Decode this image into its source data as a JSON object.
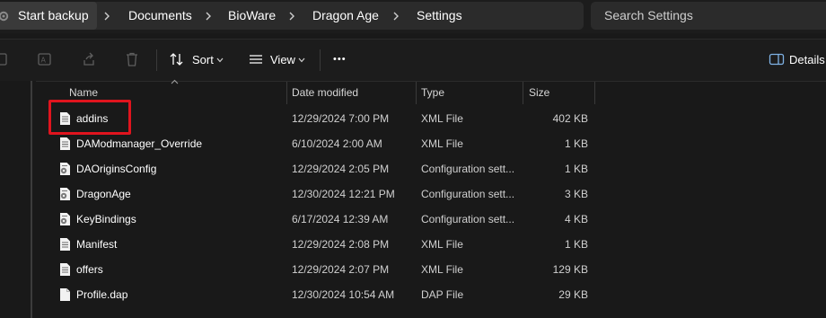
{
  "address_bar": {
    "first_crumb": "Start backup",
    "crumbs": [
      "Documents",
      "BioWare",
      "Dragon Age",
      "Settings"
    ],
    "search_placeholder": "Search Settings"
  },
  "toolbar": {
    "sort_label": "Sort",
    "view_label": "View",
    "more_label": "•••",
    "details_label": "Details"
  },
  "columns": {
    "name": "Name",
    "date": "Date modified",
    "type": "Type",
    "size": "Size"
  },
  "files": [
    {
      "name": "addins",
      "date": "12/29/2024 7:00 PM",
      "type": "XML File",
      "size": "402 KB",
      "icon": "xml-file-icon"
    },
    {
      "name": "DAModmanager_Override",
      "date": "6/10/2024 2:00 AM",
      "type": "XML File",
      "size": "1 KB",
      "icon": "xml-file-icon"
    },
    {
      "name": "DAOriginsConfig",
      "date": "12/29/2024 2:05 PM",
      "type": "Configuration sett...",
      "size": "1 KB",
      "icon": "config-file-icon"
    },
    {
      "name": "DragonAge",
      "date": "12/30/2024 12:21 PM",
      "type": "Configuration sett...",
      "size": "3 KB",
      "icon": "config-file-icon"
    },
    {
      "name": "KeyBindings",
      "date": "6/17/2024 12:39 AM",
      "type": "Configuration sett...",
      "size": "4 KB",
      "icon": "config-file-icon"
    },
    {
      "name": "Manifest",
      "date": "12/29/2024 2:08 PM",
      "type": "XML File",
      "size": "1 KB",
      "icon": "xml-file-icon"
    },
    {
      "name": "offers",
      "date": "12/29/2024 2:07 PM",
      "type": "XML File",
      "size": "129 KB",
      "icon": "xml-file-icon"
    },
    {
      "name": "Profile.dap",
      "date": "12/30/2024 10:54 AM",
      "type": "DAP File",
      "size": "29 KB",
      "icon": "generic-file-icon"
    }
  ],
  "colors": {
    "background": "#191919",
    "highlight": "#e0141e"
  }
}
